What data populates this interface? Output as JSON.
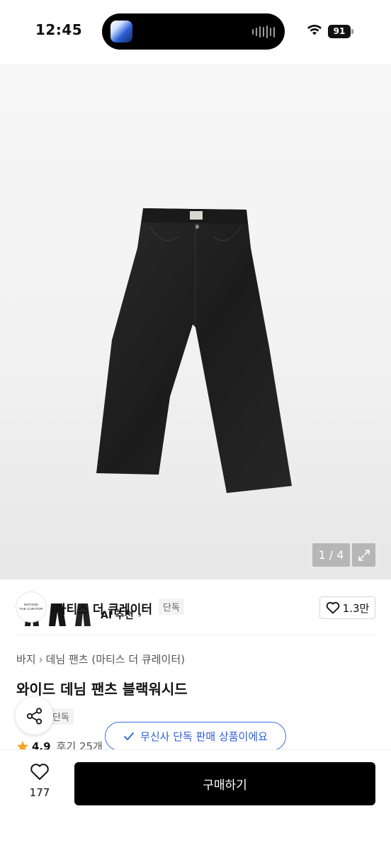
{
  "status_bar": {
    "time": "12:45",
    "battery": "91",
    "island_app_icon": "music-app-icon"
  },
  "nav": {
    "back_icon": "chevron-left-icon",
    "home_icon": "home-icon",
    "search_icon": "search-icon",
    "cart_icon": "shopping-bag-icon"
  },
  "gallery": {
    "ai_label": "AI 추천",
    "pager": "1 / 4",
    "expand_icon": "expand-icon",
    "thumbnail_count": 3
  },
  "brand": {
    "logo_lines": [
      "MATISSE",
      "THE CURATOR"
    ],
    "name": "마티스 더 큐레이터",
    "badge": "단독",
    "like_count": "1.3만"
  },
  "product": {
    "breadcrumb": [
      "바지",
      "데님 팬츠 (마티스 더 큐레이터)"
    ],
    "title": "와이드 데님 팬츠 블랙워시드",
    "tag": "단독",
    "rating": "4.9",
    "reviews": "후기 25개"
  },
  "toast": {
    "text": "무신사 단독 판매 상품이에요"
  },
  "bottom_bar": {
    "wish_count": "177",
    "buy_label": "구매하기"
  },
  "colors": {
    "accent_blue": "#2e5fd6",
    "star": "#f5a623",
    "buy_button": "#000000"
  }
}
